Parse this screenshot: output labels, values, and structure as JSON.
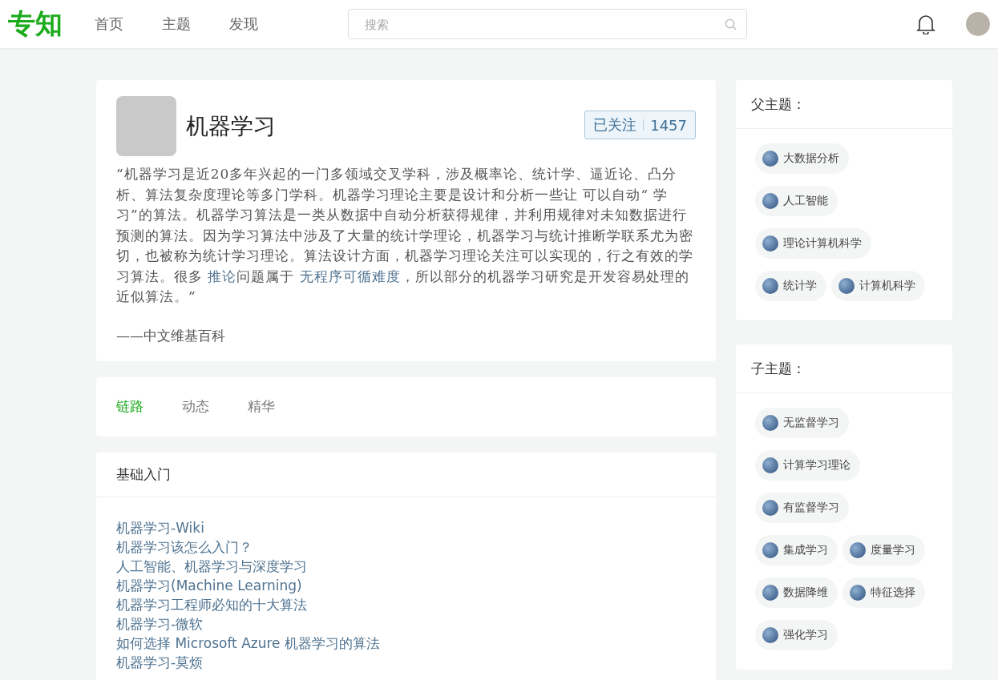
{
  "header": {
    "logo": "专知",
    "nav": [
      {
        "label": "首页",
        "selected": false
      },
      {
        "label": "主题",
        "selected": false
      },
      {
        "label": "发现",
        "selected": false
      }
    ],
    "search": {
      "placeholder": "搜索"
    }
  },
  "topic": {
    "title": "机器学习",
    "follow": {
      "label": "已关注",
      "count": "1457",
      "following": true
    },
    "description": [
      {
        "kind": "text",
        "text": "“机器学习是近20多年兴起的一门多领域交叉学科，涉及概率论、统计学、逼近论、凸分析、算法复杂度理论等多门学科。机器学习理论主要是设计和分析一些让 可以自动“ 学习”的算法。机器学习算法是一类从数据中自动分析获得规律，并利用规律对未知数据进行预测的算法。因为学习算法中涉及了大量的统计学理论，机器学习与统计推断学联系尤为密切，也被称为统计学习理论。算法设计方面，机器学习理论关注可以实现的，行之有效的学习算法。很多 "
      },
      {
        "kind": "link",
        "text": "推论"
      },
      {
        "kind": "text",
        "text": "问题属于 "
      },
      {
        "kind": "link",
        "text": "无程序可循难度"
      },
      {
        "kind": "text",
        "text": "，所以部分的机器学习研究是开发容易处理的近似算法。”"
      }
    ],
    "source": "——中文维基百科"
  },
  "tabs": [
    {
      "label": "链路",
      "selected": true
    },
    {
      "label": "动态",
      "selected": false
    },
    {
      "label": "精华",
      "selected": false
    }
  ],
  "section": {
    "title": "基础入门",
    "links": [
      "机器学习-Wiki",
      "机器学习该怎么入门？",
      "人工智能、机器学习与深度学习",
      "机器学习(Machine Learning)",
      "机器学习工程师必知的十大算法",
      "机器学习-微软",
      "如何选择 Microsoft Azure 机器学习的算法",
      "机器学习-莫烦"
    ]
  },
  "parent_topics": {
    "title": "父主题：",
    "items": [
      "大数据分析",
      "人工智能",
      "理论计算机科学",
      "统计学",
      "计算机科学"
    ]
  },
  "child_topics": {
    "title": "子主题：",
    "items": [
      "无监督学习",
      "计算学习理论",
      "有监督学习",
      "集成学习",
      "度量学习",
      "数据降维",
      "特征选择",
      "强化学习"
    ]
  }
}
